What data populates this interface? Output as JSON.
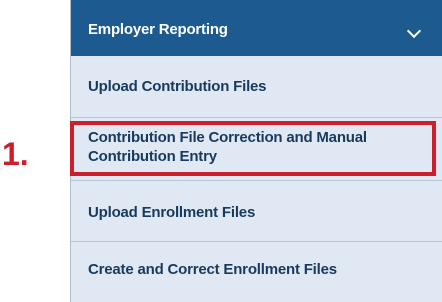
{
  "annotation": {
    "step_number": "1.",
    "highlight_color": "#cc1f2b"
  },
  "menu": {
    "header": {
      "title": "Employer Reporting",
      "icon": "chevron-down-icon",
      "background": "#1d5a8f"
    },
    "items": [
      {
        "label": "Upload Contribution Files"
      },
      {
        "label": "Contribution File Correction and Manual Contribution Entry",
        "highlighted": true
      },
      {
        "label": "Upload Enrollment Files"
      },
      {
        "label": "Create and Correct Enrollment Files"
      }
    ]
  }
}
